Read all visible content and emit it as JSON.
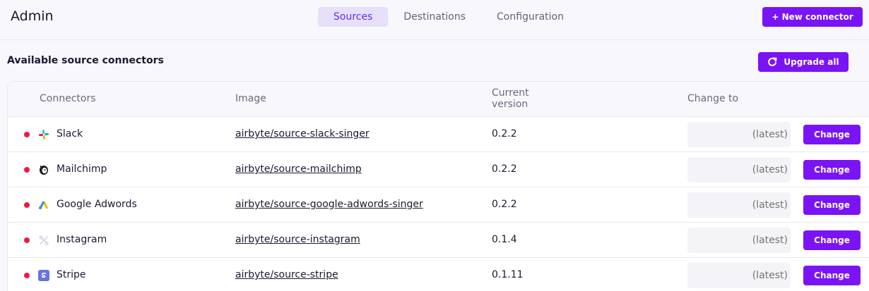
{
  "header": {
    "title": "Admin",
    "tabs": [
      {
        "label": "Sources",
        "active": true
      },
      {
        "label": "Destinations",
        "active": false
      },
      {
        "label": "Configuration",
        "active": false
      }
    ],
    "new_connector_label": "+ New connector"
  },
  "section": {
    "title": "Available source connectors",
    "upgrade_label": "Upgrade all"
  },
  "table": {
    "columns": {
      "connectors": "Connectors",
      "image": "Image",
      "current_version": "Current version",
      "change_to": "Change to"
    },
    "rows": [
      {
        "name": "Slack",
        "icon": "slack-icon",
        "image": "airbyte/source-slack-singer",
        "version": "0.2.2",
        "placeholder": "(latest)",
        "button": "Change"
      },
      {
        "name": "Mailchimp",
        "icon": "mailchimp-icon",
        "image": "airbyte/source-mailchimp",
        "version": "0.2.2",
        "placeholder": "(latest)",
        "button": "Change"
      },
      {
        "name": "Google Adwords",
        "icon": "google-adwords-icon",
        "image": "airbyte/source-google-adwords-singer",
        "version": "0.2.2",
        "placeholder": "(latest)",
        "button": "Change"
      },
      {
        "name": "Instagram",
        "icon": "instagram-icon",
        "image": "airbyte/source-instagram",
        "version": "0.1.4",
        "placeholder": "(latest)",
        "button": "Change"
      },
      {
        "name": "Stripe",
        "icon": "stripe-icon",
        "image": "airbyte/source-stripe",
        "version": "0.1.11",
        "placeholder": "(latest)",
        "button": "Change"
      }
    ]
  },
  "colors": {
    "accent": "#7a14f5",
    "active_tab_bg": "#e6e0fb",
    "status_dot": "#ec1c3f"
  }
}
